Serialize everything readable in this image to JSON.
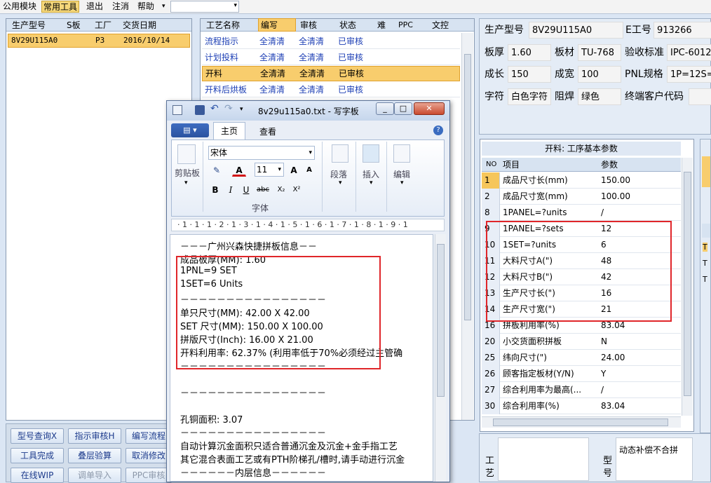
{
  "menubar": {
    "items": [
      "公用模块",
      "常用工具",
      "退出",
      "注消",
      "帮助"
    ],
    "dropdown_arrow": "▾"
  },
  "left_table": {
    "headers": [
      "生产型号",
      "S板",
      "工厂",
      "交货日期"
    ],
    "rows": [
      [
        "8V29U115A0",
        "",
        "P3",
        "2016/10/14"
      ]
    ]
  },
  "process_table": {
    "headers": [
      "工艺名称",
      "编写",
      "审核",
      "状态",
      "难",
      "PPC",
      "文控"
    ],
    "rows": [
      [
        "流程指示",
        "全清清",
        "全清清",
        "已审核"
      ],
      [
        "计划投料",
        "全清清",
        "全清清",
        "已审核"
      ],
      [
        "开料",
        "全清清",
        "全清清",
        "已审核"
      ],
      [
        "开料后烘板",
        "全清清",
        "全清清",
        "已审核"
      ]
    ]
  },
  "info": {
    "model_label": "生产型号",
    "model_value": "8V29U115A0",
    "eno_label": "E工号",
    "eno_value": "913266",
    "thick_label": "板厚",
    "thick_value": "1.60",
    "material_label": "板材",
    "material_value": "TU-768",
    "std_label": "验收标准",
    "std_value": "IPC-6012",
    "length_label": "成长",
    "length_value": "150",
    "width_label": "成宽",
    "width_value": "100",
    "pnl_label": "PNL规格",
    "pnl_value": "1P=12S=",
    "char_label": "字符",
    "char_value": "白色字符",
    "mask_label": "阻焊",
    "mask_value": "绿色",
    "customer_label": "终端客户代码",
    "customer_value": ""
  },
  "params": {
    "title": "开料: 工序基本参数",
    "col_no": "NO",
    "col_item": "项目",
    "col_value": "参数",
    "rows": [
      [
        "1",
        "成品尺寸长(mm)",
        "150.00"
      ],
      [
        "2",
        "成品尺寸宽(mm)",
        "100.00"
      ],
      [
        "8",
        "1PANEL=?units",
        "/"
      ],
      [
        "9",
        "1PANEL=?sets",
        "12"
      ],
      [
        "10",
        "1SET=?units",
        "6"
      ],
      [
        "11",
        "大料尺寸A(\")",
        "48"
      ],
      [
        "12",
        "大料尺寸B(\")",
        "42"
      ],
      [
        "13",
        "生产尺寸长(\")",
        "16"
      ],
      [
        "14",
        "生产尺寸宽(\")",
        "21"
      ],
      [
        "16",
        "拼板利用率(%)",
        "83.04"
      ],
      [
        "20",
        "小交货面积拼板",
        "N"
      ],
      [
        "25",
        "纬向尺寸(\")",
        "24.00"
      ],
      [
        "26",
        "顾客指定板材(Y/N)",
        "Y"
      ],
      [
        "27",
        "综合利用率为最高(...",
        "/"
      ],
      [
        "30",
        "综合利用率(%)",
        "83.04"
      ]
    ]
  },
  "bottom_right": {
    "process_label": "工艺",
    "model_label": "型号",
    "note": "动态补偿不合拼"
  },
  "right_edge": {
    "t1": "T",
    "t2": "T",
    "t3": "T"
  },
  "buttons": [
    [
      "型号查询X",
      "指示审核H",
      "编写流程"
    ],
    [
      "工具完成",
      "叠层验算",
      "取消修改"
    ],
    [
      "在线WIP",
      "调单导入",
      "PPC审核"
    ]
  ],
  "wordpad": {
    "title": "8v29u115a0.txt - 写字板",
    "tab_home": "主页",
    "tab_view": "查看",
    "font_name": "宋体",
    "font_size": "11",
    "grp_clipboard": "剪贴板",
    "grp_font": "字体",
    "grp_paragraph": "段落",
    "grp_insert": "插入",
    "grp_edit": "编辑",
    "ruler": "· 1 · 1 · 1 · 2 · 1 · 3 · 1 · 4 · 1 · 5 · 1 · 6 · 1 · 7 · 1 · 8 · 1 · 9 · 1",
    "lines": [
      "－－－广州兴森快捷拼板信息－－",
      "成品板厚(MM): 1.60",
      "1PNL=9 SET",
      "1SET=6 Units",
      "－－－－－－－－－－－－－－－－",
      "单只尺寸(MM): 42.00 X 42.00",
      "SET 尺寸(MM): 150.00 X 100.00",
      "拼版尺寸(Inch): 16.00 X 21.00",
      "开料利用率: 62.37% (利用率低于70%必须经过主管确",
      "－－－－－－－－－－－－－－－－",
      "",
      "－－－－－－－－－－－－－－－－",
      "",
      "孔铜面积: 3.07",
      "－－－－－－－－－－－－－－－－",
      "自动计算沉金面积只适合普通沉金及沉金+金手指工艺",
      "其它混合表面工艺或有PTH阶梯孔/槽时,请手动进行沉金",
      "－－－－－－内层信息－－－－－－"
    ]
  }
}
